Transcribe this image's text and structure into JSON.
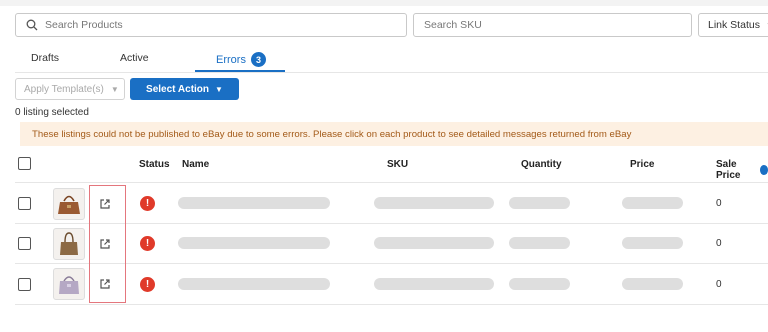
{
  "filters": {
    "search_placeholder": "Search Products",
    "sku_placeholder": "Search SKU",
    "link_status_label": "Link Status"
  },
  "tabs": [
    {
      "label": "Drafts",
      "active": false
    },
    {
      "label": "Active",
      "active": false
    },
    {
      "label": "Errors",
      "active": true,
      "badge": "3"
    }
  ],
  "toolbar": {
    "apply_template_label": "Apply Template(s)",
    "select_action_label": "Select Action"
  },
  "selection_text": "0 listing selected",
  "alert_text": "These listings could not be published to eBay due to some errors. Please click on each product to see detailed messages returned from eBay",
  "table": {
    "headers": {
      "status": "Status",
      "name": "Name",
      "sku": "SKU",
      "quantity": "Quantity",
      "price": "Price",
      "sale_price": "Sale Price"
    },
    "rows": [
      {
        "status_icon": "error-icon",
        "thumb": "brown-leather-handbag",
        "sale_price": "0"
      },
      {
        "status_icon": "error-icon",
        "thumb": "brown-tote-bag",
        "sale_price": "0"
      },
      {
        "status_icon": "error-icon",
        "thumb": "lavender-handbag",
        "sale_price": "0"
      }
    ]
  },
  "colors": {
    "accent": "#1a6fc4",
    "error": "#e03a2a",
    "alert_bg": "#fdf0e2",
    "alert_text": "#a35a18",
    "highlight_border": "#e4767d"
  }
}
